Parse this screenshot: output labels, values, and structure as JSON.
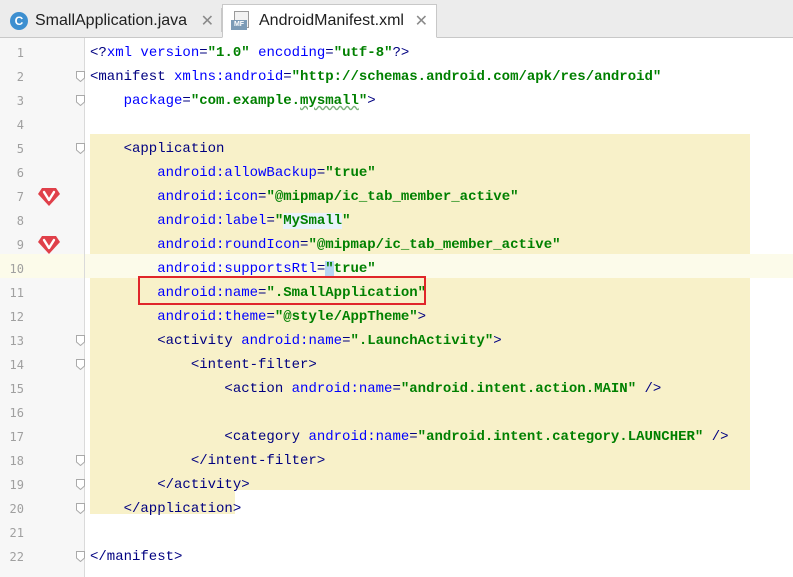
{
  "tabs": [
    {
      "label": "SmallApplication.java",
      "icon": "java-class-icon",
      "icon_letter": "C",
      "active": false
    },
    {
      "label": "AndroidManifest.xml",
      "icon": "manifest-file-icon",
      "icon_letter": "MF",
      "active": true
    }
  ],
  "close_glyph": "✕",
  "colors": {
    "highlight": "#f8f1c9",
    "red_box": "#e0262a",
    "attr": "#0000ff",
    "value": "#008000",
    "tag": "#000080"
  },
  "editor": {
    "lines": [
      {
        "n": "1",
        "tokens": [
          [
            "t",
            "<?"
          ],
          [
            "a",
            "xml version"
          ],
          [
            "t",
            "="
          ],
          [
            "v",
            "\"1.0\""
          ],
          [
            "t",
            " "
          ],
          [
            "a",
            "encoding"
          ],
          [
            "t",
            "="
          ],
          [
            "v",
            "\"utf-8\""
          ],
          [
            "t",
            "?>"
          ]
        ]
      },
      {
        "n": "2",
        "tokens": [
          [
            "t",
            "<manifest "
          ],
          [
            "a",
            "xmlns:android"
          ],
          [
            "t",
            "="
          ],
          [
            "v",
            "\"http://schemas.android.com/apk/res/android\""
          ]
        ]
      },
      {
        "n": "3",
        "tokens": [
          [
            "t",
            "    "
          ],
          [
            "a",
            "package"
          ],
          [
            "t",
            "="
          ],
          [
            "v",
            "\"com.example."
          ],
          [
            "vtypo",
            "mysmall"
          ],
          [
            "v",
            "\""
          ],
          [
            "t",
            ">"
          ]
        ]
      },
      {
        "n": "4",
        "tokens": []
      },
      {
        "n": "5",
        "tokens": [
          [
            "t",
            "    <application"
          ]
        ]
      },
      {
        "n": "6",
        "tokens": [
          [
            "t",
            "        "
          ],
          [
            "a",
            "android:allowBackup"
          ],
          [
            "t",
            "="
          ],
          [
            "v",
            "\"true\""
          ]
        ]
      },
      {
        "n": "7",
        "tokens": [
          [
            "t",
            "        "
          ],
          [
            "a",
            "android:icon"
          ],
          [
            "t",
            "="
          ],
          [
            "v",
            "\"@mipmap/ic_tab_member_active\""
          ]
        ]
      },
      {
        "n": "8",
        "tokens": [
          [
            "t",
            "        "
          ],
          [
            "a",
            "android:label"
          ],
          [
            "t",
            "="
          ],
          [
            "v",
            "\""
          ],
          [
            "vsel",
            "MySmall"
          ],
          [
            "v",
            "\""
          ]
        ]
      },
      {
        "n": "9",
        "tokens": [
          [
            "t",
            "        "
          ],
          [
            "a",
            "android:roundIcon"
          ],
          [
            "t",
            "="
          ],
          [
            "v",
            "\"@mipmap/ic_tab_member_active\""
          ]
        ]
      },
      {
        "n": "10",
        "tokens": [
          [
            "t",
            "        "
          ],
          [
            "a",
            "android:supportsRtl"
          ],
          [
            "t",
            "="
          ],
          [
            "vcur",
            "\""
          ],
          [
            "v",
            "true\""
          ]
        ]
      },
      {
        "n": "11",
        "tokens": [
          [
            "t",
            "        "
          ],
          [
            "a",
            "android:name"
          ],
          [
            "t",
            "="
          ],
          [
            "v",
            "\".SmallApplication\""
          ]
        ]
      },
      {
        "n": "12",
        "tokens": [
          [
            "t",
            "        "
          ],
          [
            "a",
            "android:theme"
          ],
          [
            "t",
            "="
          ],
          [
            "v",
            "\"@style/AppTheme\""
          ],
          [
            "t",
            ">"
          ]
        ]
      },
      {
        "n": "13",
        "tokens": [
          [
            "t",
            "        <activity "
          ],
          [
            "a",
            "android:name"
          ],
          [
            "t",
            "="
          ],
          [
            "v",
            "\".LaunchActivity\""
          ],
          [
            "t",
            ">"
          ]
        ]
      },
      {
        "n": "14",
        "tokens": [
          [
            "t",
            "            <intent-filter>"
          ]
        ]
      },
      {
        "n": "15",
        "tokens": [
          [
            "t",
            "                <action "
          ],
          [
            "a",
            "android:name"
          ],
          [
            "t",
            "="
          ],
          [
            "v",
            "\"android.intent.action.MAIN\""
          ],
          [
            "t",
            " />"
          ]
        ]
      },
      {
        "n": "16",
        "tokens": []
      },
      {
        "n": "17",
        "tokens": [
          [
            "t",
            "                <category "
          ],
          [
            "a",
            "android:name"
          ],
          [
            "t",
            "="
          ],
          [
            "v",
            "\"android.intent.category.LAUNCHER\""
          ],
          [
            "t",
            " />"
          ]
        ]
      },
      {
        "n": "18",
        "tokens": [
          [
            "t",
            "            </intent-filter>"
          ]
        ]
      },
      {
        "n": "19",
        "tokens": [
          [
            "t",
            "        </activity>"
          ]
        ]
      },
      {
        "n": "20",
        "tokens": [
          [
            "t",
            "    </application>"
          ]
        ]
      },
      {
        "n": "21",
        "tokens": []
      },
      {
        "n": "22",
        "tokens": [
          [
            "t",
            "</manifest>"
          ]
        ]
      }
    ],
    "gutter_markers": [
      {
        "line": "7",
        "icon": "vue-heart-icon"
      },
      {
        "line": "9",
        "icon": "vue-heart-icon"
      }
    ],
    "fold_markers": [
      "2",
      "3",
      "5",
      "13",
      "14",
      "18",
      "19",
      "20",
      "22"
    ],
    "current_line": "10",
    "highlighted_line": "11"
  }
}
